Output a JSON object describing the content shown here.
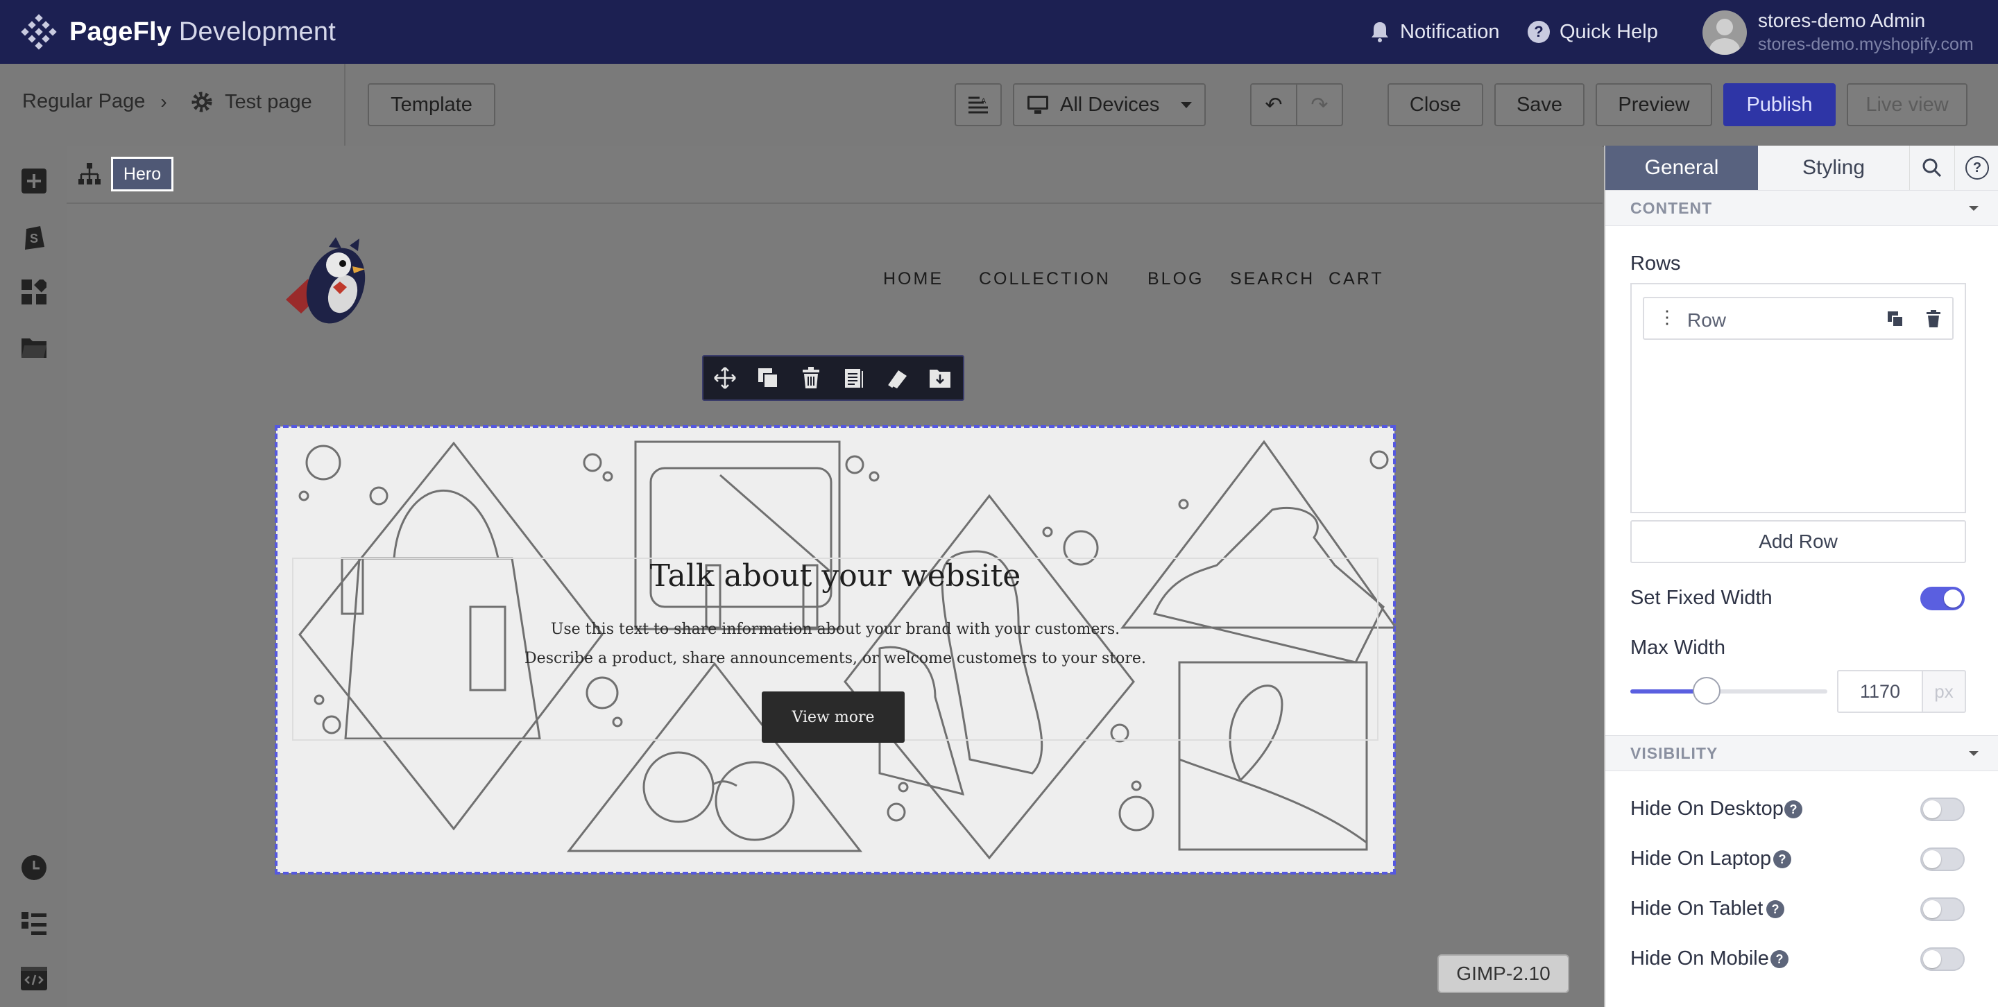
{
  "topbar": {
    "brand_bold": "PageFly",
    "brand_rest": " Development",
    "notification_label": "Notification",
    "quick_help_label": "Quick Help",
    "user_name": "stores-demo Admin",
    "user_store": "stores-demo.myshopify.com"
  },
  "toolbar": {
    "page_type": "Regular Page",
    "page_name": "Test page",
    "template_label": "Template",
    "device_label": "All Devices",
    "close_label": "Close",
    "save_label": "Save",
    "preview_label": "Preview",
    "publish_label": "Publish",
    "live_view_label": "Live view"
  },
  "breadcrumb": {
    "current": "Hero"
  },
  "preview": {
    "nav": [
      "HOME",
      "COLLECTION",
      "BLOG",
      "SEARCH",
      "CART"
    ],
    "hero_title": "Talk about your website",
    "hero_sub1": "Use this text to share information about your brand with your customers.",
    "hero_sub2": "Describe a product, share announcements, or welcome customers to your store.",
    "hero_button": "View more"
  },
  "tooltip": {
    "text": "GIMP-2.10"
  },
  "panel": {
    "tab_general": "General",
    "tab_styling": "Styling",
    "content_header": "CONTENT",
    "rows_label": "Rows",
    "row_item": "Row",
    "add_row_label": "Add Row",
    "fixed_width_label": "Set Fixed Width",
    "fixed_width_on": true,
    "max_width_label": "Max Width",
    "max_width_value": "1170",
    "max_width_unit": "px",
    "visibility_header": "VISIBILITY",
    "hide_desktop": "Hide On Desktop",
    "hide_laptop": "Hide On Laptop",
    "hide_tablet": "Hide On Tablet",
    "hide_mobile": "Hide On Mobile"
  },
  "colors": {
    "topbar": "#1c2052",
    "primary": "#2e35a6",
    "accent": "#5a5fe0",
    "active_tab": "#58627f"
  }
}
